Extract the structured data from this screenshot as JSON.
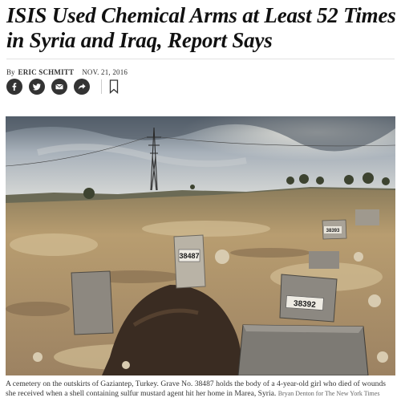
{
  "article": {
    "headline": "ISIS Used Chemical Arms at Least 52 Times in Syria and Iraq, Report Says",
    "byline_prefix": "By",
    "author": "ERIC SCHMITT",
    "date": "NOV. 21, 2016"
  },
  "share": {
    "buttons": [
      {
        "icon": "facebook-icon"
      },
      {
        "icon": "twitter-icon"
      },
      {
        "icon": "email-icon"
      },
      {
        "icon": "share-icon"
      },
      {
        "icon": "bookmark-icon"
      }
    ]
  },
  "photo": {
    "grave_labels": [
      "38487",
      "38393",
      "38392"
    ],
    "colors": {
      "sky": "#8f9aa5",
      "ground": "#b89d70",
      "soil": "#3a2c22"
    }
  },
  "caption": {
    "text": "A cemetery on the outskirts of Gaziantep, Turkey. Grave No. 38487 holds the body of a 4-year-old girl who died of wounds she received when a shell containing sulfur mustard agent hit her home in Marea, Syria.",
    "credit": "Bryan Denton for The New York Times"
  }
}
